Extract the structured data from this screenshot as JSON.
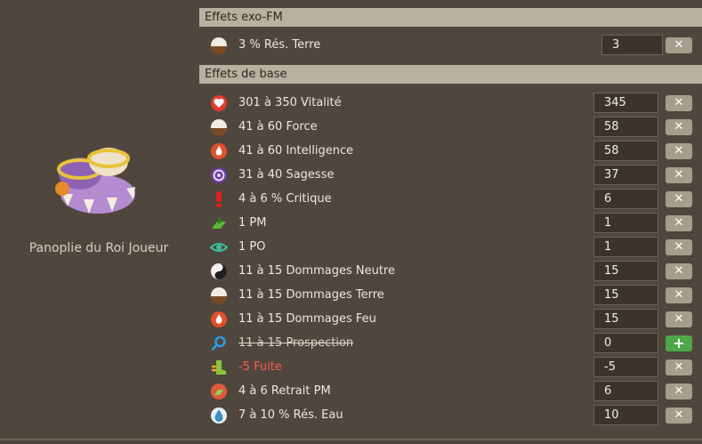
{
  "item": {
    "name": "Panoplie du Roi Joueur"
  },
  "sections": {
    "exo_title": "Effets exo-FM",
    "base_title": "Effets de base"
  },
  "buttons": {
    "remove": "✕",
    "add": "+"
  },
  "exo_effects": [
    {
      "label": "3 % Rés. Terre",
      "value": "3",
      "icon": "earth-resistance-icon"
    }
  ],
  "effects": [
    {
      "label": "301 à 350 Vitalité",
      "value": "345",
      "icon": "vitality-heart-icon"
    },
    {
      "label": "41 à 60 Force",
      "value": "58",
      "icon": "earth-strength-icon"
    },
    {
      "label": "41 à 60 Intelligence",
      "value": "58",
      "icon": "fire-intelligence-icon"
    },
    {
      "label": "31 à 40 Sagesse",
      "value": "37",
      "icon": "wisdom-spiral-icon"
    },
    {
      "label": "4 à 6 % Critique",
      "value": "6",
      "icon": "critical-exclamation-icon"
    },
    {
      "label": "1 PM",
      "value": "1",
      "icon": "movement-point-icon"
    },
    {
      "label": "1 PO",
      "value": "1",
      "icon": "range-eye-icon"
    },
    {
      "label": "11 à 15 Dommages Neutre",
      "value": "15",
      "icon": "neutral-yin-yang-icon"
    },
    {
      "label": "11 à 15 Dommages Terre",
      "value": "15",
      "icon": "earth-damage-icon"
    },
    {
      "label": "11 à 15 Dommages Feu",
      "value": "15",
      "icon": "fire-damage-icon"
    },
    {
      "label": "11 à 15 Prospection",
      "value": "0",
      "icon": "prospecting-magnifier-icon",
      "state": "struck"
    },
    {
      "label": "-5 Fuite",
      "value": "-5",
      "icon": "dodge-boot-icon",
      "state": "negative"
    },
    {
      "label": "4 à 6 Retrait PM",
      "value": "6",
      "icon": "mp-reduction-icon"
    },
    {
      "label": "7 à 10 % Rés. Eau",
      "value": "10",
      "icon": "water-resistance-icon"
    }
  ],
  "colors": {
    "background": "#4f473d",
    "header": "#b9b1a0",
    "remove_button": "#a69d8c",
    "add_button": "#4ea84a",
    "negative_text": "#ff5a4e"
  }
}
